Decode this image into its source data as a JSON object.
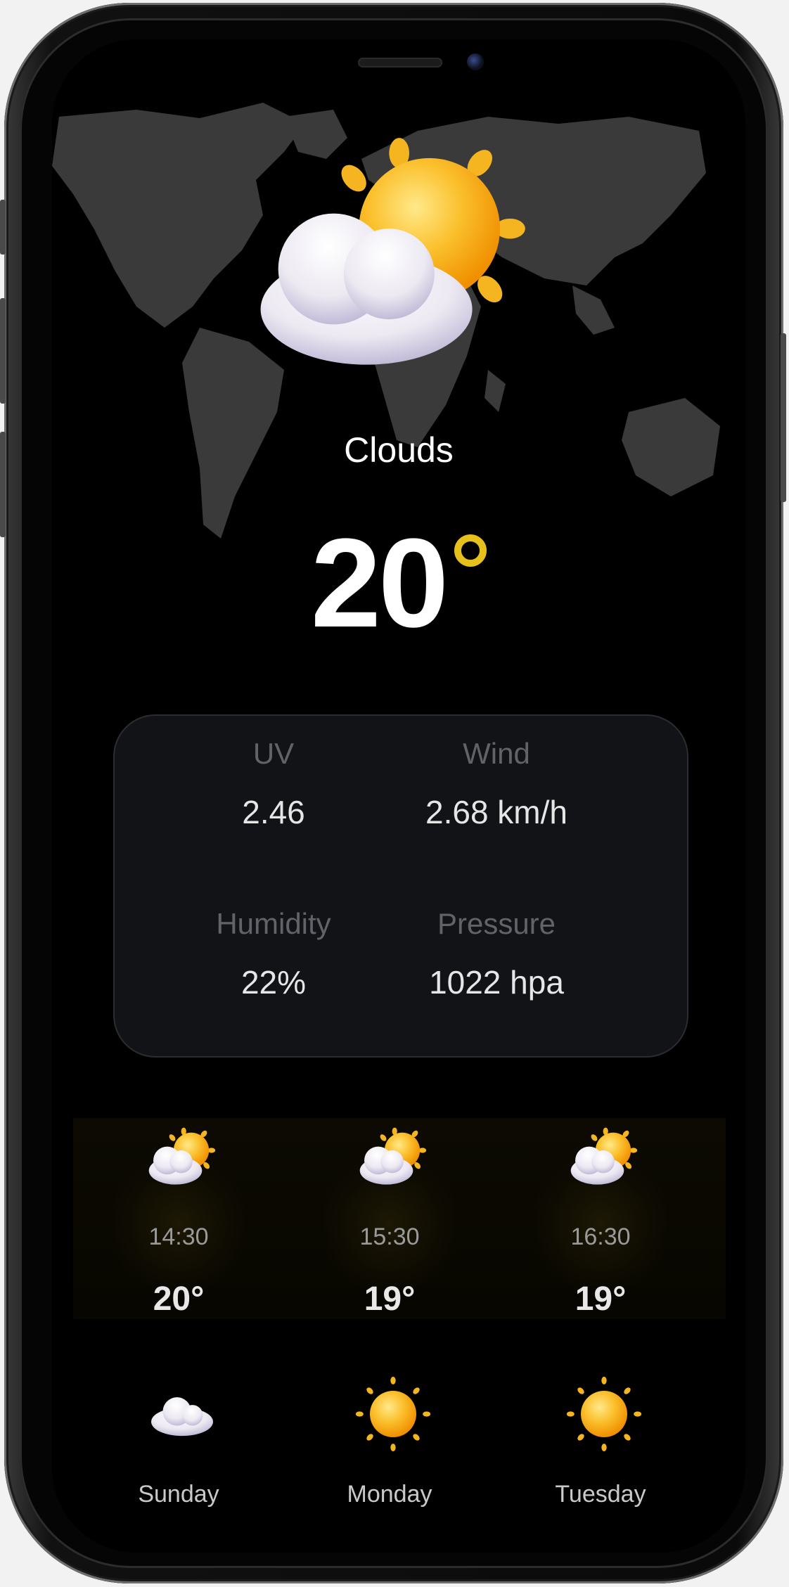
{
  "current": {
    "condition": "Clouds",
    "temperature": "20",
    "icon": "sun-behind-cloud-icon"
  },
  "stats": {
    "uv": {
      "label": "UV",
      "value": "2.46"
    },
    "wind": {
      "label": "Wind",
      "value": "2.68 km/h"
    },
    "humidity": {
      "label": "Humidity",
      "value": "22%"
    },
    "pressure": {
      "label": "Pressure",
      "value": "1022 hpa"
    }
  },
  "hourly": [
    {
      "time": "14:30",
      "temp": "20°",
      "icon": "sun-behind-cloud-icon"
    },
    {
      "time": "15:30",
      "temp": "19°",
      "icon": "sun-behind-cloud-icon"
    },
    {
      "time": "16:30",
      "temp": "19°",
      "icon": "sun-behind-cloud-icon"
    }
  ],
  "daily": [
    {
      "day": "Sunday",
      "icon": "cloud-icon"
    },
    {
      "day": "Monday",
      "icon": "sun-icon"
    },
    {
      "day": "Tuesday",
      "icon": "sun-icon"
    }
  ],
  "colors": {
    "background": "#000000",
    "accent_degree": "#e6c11c",
    "card": "#111317",
    "map": "#3a3a3a"
  }
}
